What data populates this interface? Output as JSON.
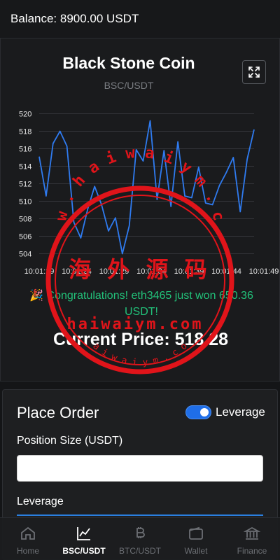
{
  "header": {
    "balance": "Balance: 8900.00 USDT"
  },
  "chart_card": {
    "title": "Black Stone Coin",
    "pair": "BSC/USDT",
    "expand_icon": "expand-icon"
  },
  "chart_data": {
    "type": "line",
    "x_ticks": [
      "10:01:19",
      "10:01:24",
      "10:01:29",
      "10:01:34",
      "10:01:39",
      "10:01:44",
      "10:01:49"
    ],
    "y_ticks": [
      504,
      506,
      508,
      510,
      512,
      514,
      516,
      518,
      520
    ],
    "ylim": [
      503,
      521
    ],
    "grid": true,
    "color": "#2f7bf0",
    "series": [
      {
        "values": [
          515.1,
          510.6,
          516.6,
          518.0,
          516.3,
          507.6,
          505.8,
          509.1,
          511.7,
          509.6,
          506.6,
          508.1,
          504.0,
          507.2,
          515.9,
          514.6,
          519.2,
          510.2,
          515.8,
          509.4,
          516.8,
          510.6,
          510.4,
          513.9,
          509.8,
          509.6,
          511.8,
          513.3,
          515.0,
          508.8,
          514.8,
          518.2
        ]
      }
    ]
  },
  "congrats": "🎉 Congratulations! eth3465 just won 650.36 USDT!",
  "current_price": "Current Price: 518.28",
  "watermark": {
    "ring_text": "w w w . h a i w a i y m . c o m",
    "chinese": "海 外 源 码",
    "domain": "haiwaiym.com",
    "small": "h a i w a i y m . c o m"
  },
  "order": {
    "title": "Place Order",
    "leverage_toggle_label": "Leverage",
    "leverage_toggle_on": true,
    "position_label": "Position Size (USDT)",
    "position_value": "",
    "leverage_label": "Leverage"
  },
  "nav": [
    {
      "label": "Home",
      "icon": "home-icon",
      "active": false
    },
    {
      "label": "BSC/USDT",
      "icon": "chart-line-icon",
      "active": true
    },
    {
      "label": "BTC/USDT",
      "icon": "bitcoin-icon",
      "active": false
    },
    {
      "label": "Wallet",
      "icon": "wallet-icon",
      "active": false
    },
    {
      "label": "Finance",
      "icon": "bank-icon",
      "active": false
    }
  ]
}
